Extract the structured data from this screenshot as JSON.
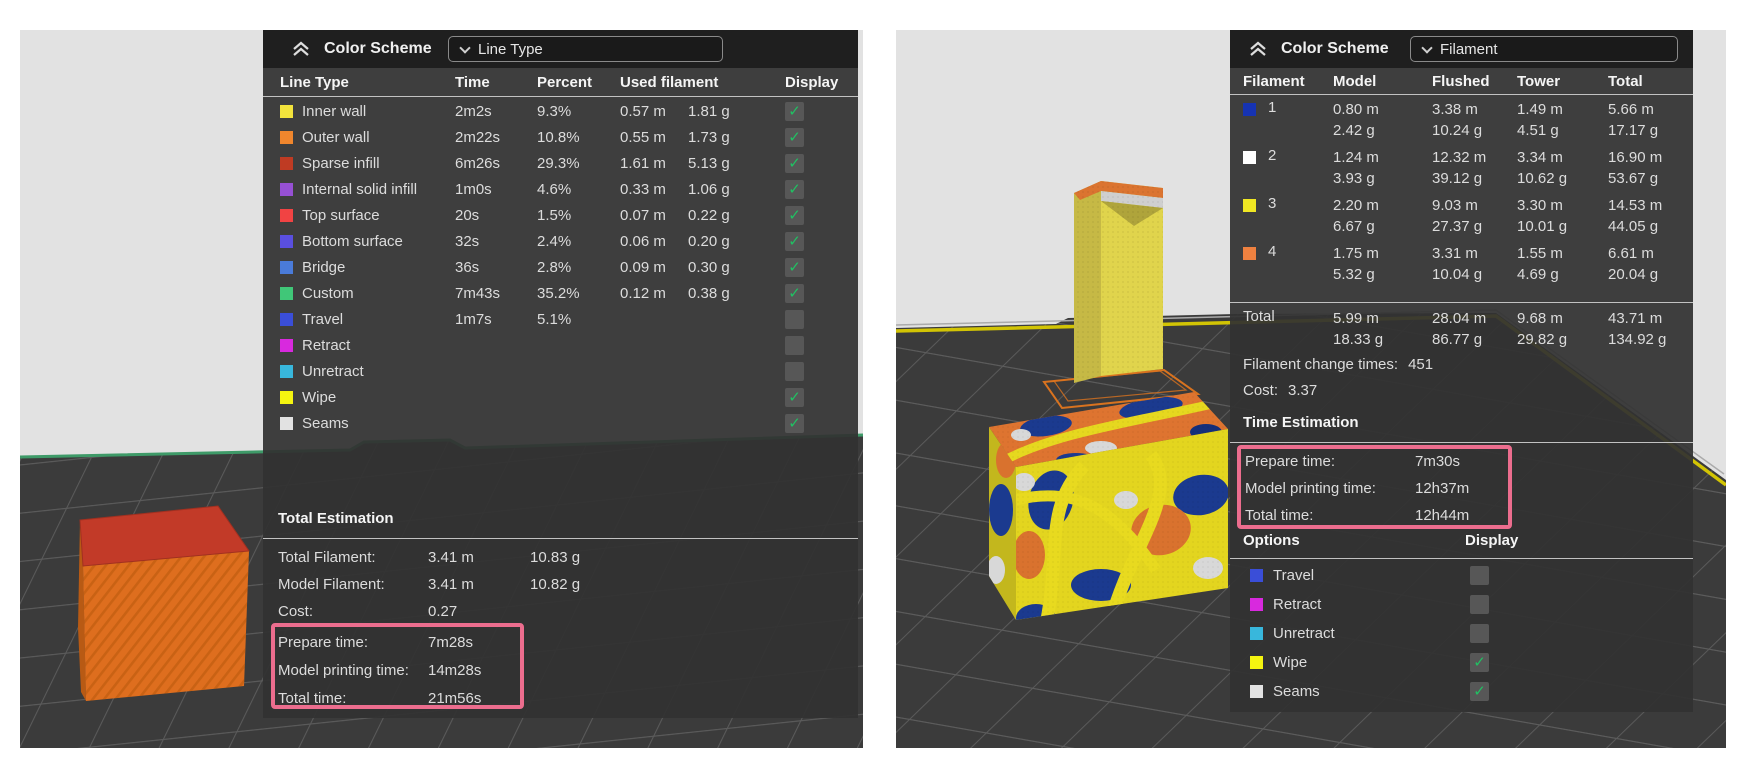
{
  "left_shot": {
    "panel": {
      "title": "Color Scheme",
      "dropdown_value": "Line Type",
      "columns": {
        "c1": "Line Type",
        "c2": "Time",
        "c3": "Percent",
        "c4": "Used filament",
        "c5": "Display"
      },
      "rows": [
        {
          "label": "Inner wall",
          "color": "#F2E33C",
          "time": "2m2s",
          "percent": "9.3%",
          "len": "0.57 m",
          "wt": "1.81 g",
          "check": "✓"
        },
        {
          "label": "Outer wall",
          "color": "#F0862D",
          "time": "2m22s",
          "percent": "10.8%",
          "len": "0.55 m",
          "wt": "1.73 g",
          "check": "✓"
        },
        {
          "label": "Sparse infill",
          "color": "#BF3B23",
          "time": "6m26s",
          "percent": "29.3%",
          "len": "1.61 m",
          "wt": "5.13 g",
          "check": "✓"
        },
        {
          "label": "Internal solid infill",
          "color": "#9650D4",
          "time": "1m0s",
          "percent": "4.6%",
          "len": "0.33 m",
          "wt": "1.06 g",
          "check": "✓"
        },
        {
          "label": "Top surface",
          "color": "#F14343",
          "time": "20s",
          "percent": "1.5%",
          "len": "0.07 m",
          "wt": "0.22 g",
          "check": "✓"
        },
        {
          "label": "Bottom surface",
          "color": "#5A4FE0",
          "time": "32s",
          "percent": "2.4%",
          "len": "0.06 m",
          "wt": "0.20 g",
          "check": "✓"
        },
        {
          "label": "Bridge",
          "color": "#4A7BD9",
          "time": "36s",
          "percent": "2.8%",
          "len": "0.09 m",
          "wt": "0.30 g",
          "check": "✓"
        },
        {
          "label": "Custom",
          "color": "#40C778",
          "time": "7m43s",
          "percent": "35.2%",
          "len": "0.12 m",
          "wt": "0.38 g",
          "check": "✓"
        },
        {
          "label": "Travel",
          "color": "#3A4ED8",
          "time": "1m7s",
          "percent": "5.1%",
          "len": "",
          "wt": "",
          "check": ""
        },
        {
          "label": "Retract",
          "color": "#D829DE",
          "time": "",
          "percent": "",
          "len": "",
          "wt": "",
          "check": ""
        },
        {
          "label": "Unretract",
          "color": "#38B7DC",
          "time": "",
          "percent": "",
          "len": "",
          "wt": "",
          "check": ""
        },
        {
          "label": "Wipe",
          "color": "#F4F410",
          "time": "",
          "percent": "",
          "len": "",
          "wt": "",
          "check": "✓"
        },
        {
          "label": "Seams",
          "color": "#E2E2E2",
          "time": "",
          "percent": "",
          "len": "",
          "wt": "",
          "check": "✓"
        }
      ],
      "total_estimation": {
        "title": "Total Estimation",
        "rows": [
          {
            "label": "Total Filament:",
            "v1": "3.41 m",
            "v2": "10.83 g"
          },
          {
            "label": "Model Filament:",
            "v1": "3.41 m",
            "v2": "10.82 g"
          },
          {
            "label": "Cost:",
            "v1": "0.27",
            "v2": ""
          }
        ],
        "highlight": [
          {
            "label": "Prepare time:",
            "value": "7m28s"
          },
          {
            "label": "Model printing time:",
            "value": "14m28s"
          },
          {
            "label": "Total time:",
            "value": "21m56s"
          }
        ]
      }
    }
  },
  "right_shot": {
    "panel": {
      "title": "Color Scheme",
      "dropdown_value": "Filament",
      "columns": {
        "c1": "Filament",
        "c2": "Model",
        "c3": "Flushed",
        "c4": "Tower",
        "c5": "Total"
      },
      "rows": [
        {
          "n": "1",
          "color": "#1633B2",
          "model_m": "0.80 m",
          "model_g": "2.42 g",
          "flushed_m": "3.38 m",
          "flushed_g": "10.24 g",
          "tower_m": "1.49 m",
          "tower_g": "4.51 g",
          "total_m": "5.66 m",
          "total_g": "17.17 g"
        },
        {
          "n": "2",
          "color": "#FFFFFF",
          "model_m": "1.24 m",
          "model_g": "3.93 g",
          "flushed_m": "12.32 m",
          "flushed_g": "39.12 g",
          "tower_m": "3.34 m",
          "tower_g": "10.62 g",
          "total_m": "16.90 m",
          "total_g": "53.67 g"
        },
        {
          "n": "3",
          "color": "#F0E723",
          "model_m": "2.20 m",
          "model_g": "6.67 g",
          "flushed_m": "9.03 m",
          "flushed_g": "27.37 g",
          "tower_m": "3.30 m",
          "tower_g": "10.01 g",
          "total_m": "14.53 m",
          "total_g": "44.05 g"
        },
        {
          "n": "4",
          "color": "#EF8140",
          "model_m": "1.75 m",
          "model_g": "5.32 g",
          "flushed_m": "3.31 m",
          "flushed_g": "10.04 g",
          "tower_m": "1.55 m",
          "tower_g": "4.69 g",
          "total_m": "6.61 m",
          "total_g": "20.04 g"
        }
      ],
      "total_row": {
        "label": "Total",
        "model_m": "5.99 m",
        "model_g": "18.33 g",
        "flushed_m": "28.04 m",
        "flushed_g": "86.77 g",
        "tower_m": "9.68 m",
        "tower_g": "29.82 g",
        "total_m": "43.71 m",
        "total_g": "134.92 g"
      },
      "filament_change": {
        "label": "Filament change times:",
        "value": "451"
      },
      "cost": {
        "label": "Cost:",
        "value": "3.37"
      },
      "time_estimation": {
        "title": "Time Estimation",
        "highlight": [
          {
            "label": "Prepare time:",
            "value": "7m30s"
          },
          {
            "label": "Model printing time:",
            "value": "12h37m"
          },
          {
            "label": "Total time:",
            "value": "12h44m"
          }
        ]
      },
      "options": {
        "title": "Options",
        "display_label": "Display",
        "rows": [
          {
            "label": "Travel",
            "color": "#3A4ED8",
            "check": ""
          },
          {
            "label": "Retract",
            "color": "#D829DE",
            "check": ""
          },
          {
            "label": "Unretract",
            "color": "#38B7DC",
            "check": ""
          },
          {
            "label": "Wipe",
            "color": "#F4F410",
            "check": "✓"
          },
          {
            "label": "Seams",
            "color": "#E2E2E2",
            "check": "✓"
          }
        ]
      }
    }
  },
  "accent": {
    "highlight_box": "#EC6D8E",
    "check_green": "#21C063"
  }
}
